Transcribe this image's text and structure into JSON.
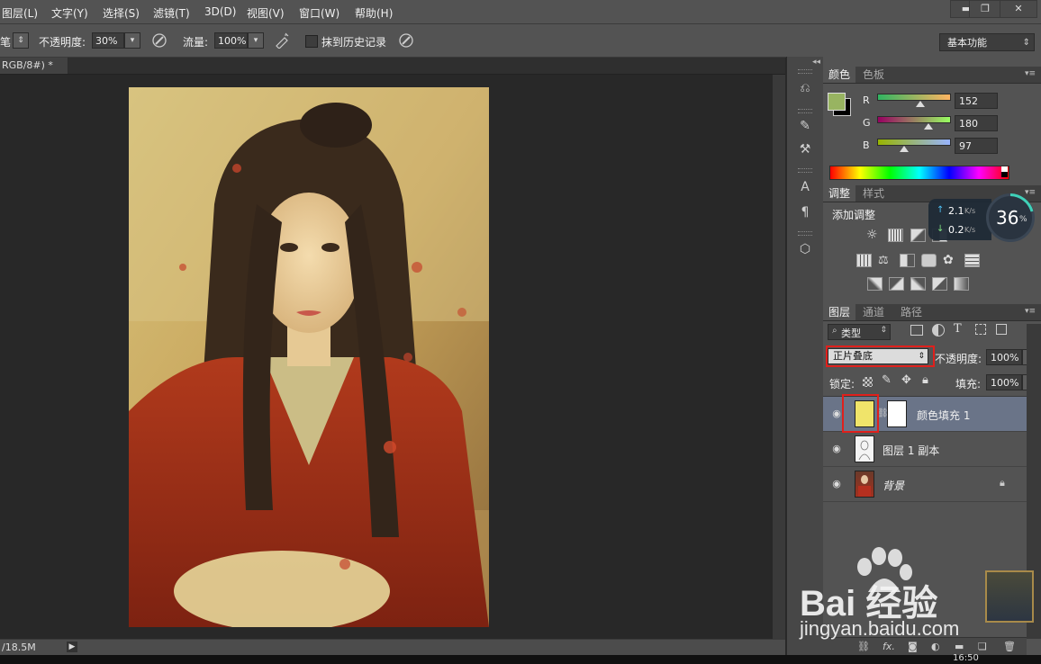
{
  "menubar": {
    "items": [
      "图层(L)",
      "文字(Y)",
      "选择(S)",
      "滤镜(T)",
      "3D(D)",
      "视图(V)",
      "窗口(W)",
      "帮助(H)"
    ],
    "window_buttons": [
      "minimize",
      "restore",
      "close"
    ]
  },
  "options": {
    "tool_preset_partial": "笔",
    "opacity_label": "不透明度:",
    "opacity_value": "30%",
    "flow_label": "流量:",
    "flow_value": "100%",
    "history_label": "抹到历史记录",
    "workspace": "基本功能"
  },
  "document": {
    "tab_title": "RGB/8#) *",
    "tab_close": "×",
    "status_size": "/18.5M"
  },
  "color_panel": {
    "tabs": [
      "颜色",
      "色板"
    ],
    "active_tab": "颜色",
    "channels": [
      {
        "label": "R",
        "value": "152",
        "fraction": 0.6
      },
      {
        "label": "G",
        "value": "180",
        "fraction": 0.71
      },
      {
        "label": "B",
        "value": "97",
        "fraction": 0.38
      }
    ],
    "foreground_color": "#98b461",
    "background_color": "#000000"
  },
  "adjust_panel": {
    "tabs": [
      "调整",
      "样式"
    ],
    "active_tab": "调整",
    "add_label": "添加调整"
  },
  "net_widget": {
    "up": "2.1",
    "down": "0.2",
    "unit": "K/s",
    "percent": "36",
    "percent_sign": "%"
  },
  "layers_panel": {
    "tabs": [
      "图层",
      "通道",
      "路径"
    ],
    "active_tab": "图层",
    "filter_label": "类型",
    "blend_mode": "正片叠底",
    "opacity_label": "不透明度:",
    "opacity_value": "100%",
    "lock_label": "锁定:",
    "fill_label": "填充:",
    "fill_value": "100%",
    "layers": [
      {
        "name": "颜色填充 1",
        "selected": true,
        "fill_color": "#f0e46a"
      },
      {
        "name": "图层 1 副本",
        "selected": false
      },
      {
        "name": "背景",
        "selected": false,
        "locked": true
      }
    ]
  },
  "watermark": {
    "brand": "Bai 经验",
    "url": "jingyan.baidu.com"
  },
  "taskbar": {
    "clock": "16:50"
  }
}
